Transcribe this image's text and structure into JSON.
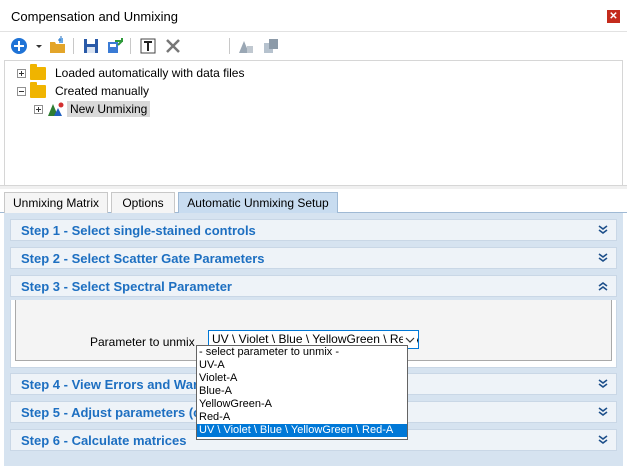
{
  "window": {
    "title": "Compensation and Unmixing",
    "close_glyph": "✕"
  },
  "toolbar": {
    "buttons": [
      {
        "name": "add-icon",
        "interactable": true
      },
      {
        "name": "dropdown-arrow-icon",
        "interactable": true
      },
      {
        "name": "open-folder-icon",
        "interactable": true
      },
      {
        "name": "save-icon",
        "interactable": true
      },
      {
        "name": "export-icon",
        "interactable": true
      },
      {
        "name": "rename-icon",
        "interactable": true
      },
      {
        "name": "delete-icon",
        "interactable": true
      },
      {
        "name": "apply-icon",
        "interactable": false
      },
      {
        "name": "copy-icon",
        "interactable": false
      }
    ]
  },
  "tree": {
    "items": [
      {
        "label": "Loaded automatically with data files",
        "expander": "plus"
      },
      {
        "label": "Created manually",
        "expander": "minus"
      },
      {
        "label": "New Unmixing",
        "expander": "plus",
        "selected": true
      }
    ]
  },
  "tabs": [
    {
      "label": "Unmixing Matrix",
      "active": false
    },
    {
      "label": "Options",
      "active": false
    },
    {
      "label": "Automatic Unmixing Setup",
      "active": true
    }
  ],
  "steps": [
    {
      "title": "Step 1 - Select single-stained controls",
      "expanded": false
    },
    {
      "title": "Step 2 - Select Scatter Gate Parameters",
      "expanded": false
    },
    {
      "title": "Step 3 - Select Spectral Parameter",
      "expanded": true
    },
    {
      "title": "Step 4 - View Errors and Warnings",
      "expanded": false
    },
    {
      "title": "Step 5 - Adjust parameters (optional)",
      "expanded": false
    },
    {
      "title": "Step 6 - Calculate matrices",
      "expanded": false
    }
  ],
  "step3": {
    "param_label": "Parameter to unmix",
    "selected_value": "UV \\ Violet \\ Blue \\ YellowGreen \\ Red-A",
    "options": [
      "- select parameter to unmix -",
      "UV-A",
      "Violet-A",
      "Blue-A",
      "YellowGreen-A",
      "Red-A",
      "UV \\ Violet \\ Blue \\ YellowGreen \\ Red-A"
    ],
    "selected_index": 6
  },
  "colors": {
    "accent": "#1d6fc1",
    "selection": "#0078d7",
    "panel_bg": "#d6e3f0",
    "tab_active": "#c8dcf0",
    "folder": "#f0b400",
    "close": "#c42b1c"
  }
}
